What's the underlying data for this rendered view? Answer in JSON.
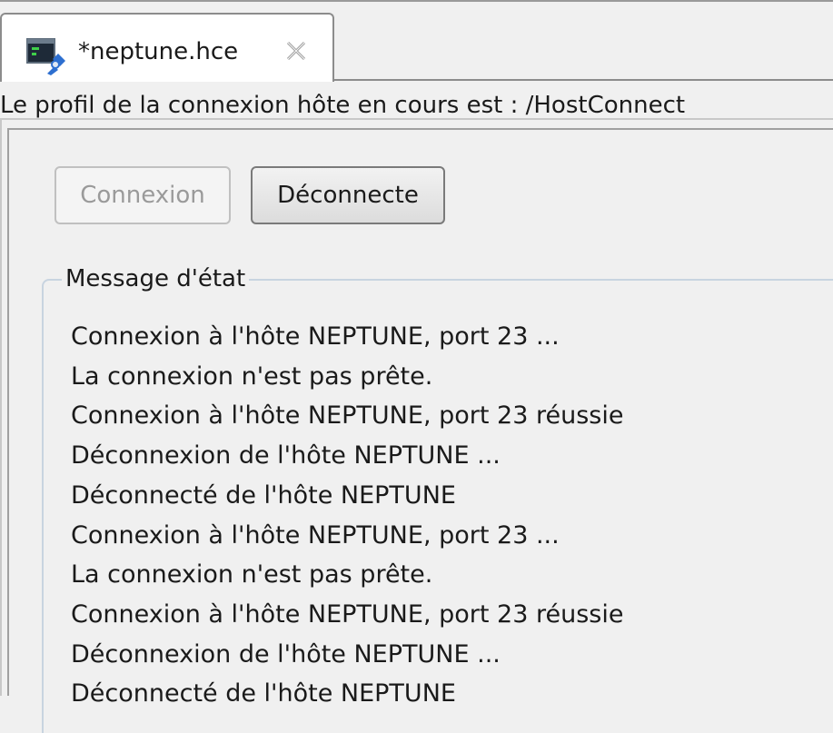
{
  "tab": {
    "title": "*neptune.hce",
    "icon": "host-terminal-icon",
    "close_icon": "close-icon"
  },
  "profile_line": "Le profil de la connexion hôte en cours est : /HostConnect",
  "buttons": {
    "connect_label": "Connexion",
    "disconnect_label": "Déconnecte"
  },
  "status": {
    "legend": "Message d'état",
    "messages": [
      "Connexion à l'hôte NEPTUNE, port 23 ...",
      "La connexion n'est pas prête.",
      "Connexion à l'hôte NEPTUNE, port 23 réussie",
      "Déconnexion de l'hôte NEPTUNE ...",
      "Déconnecté de l'hôte NEPTUNE",
      "Connexion à l'hôte NEPTUNE, port 23 ...",
      "La connexion n'est pas prête.",
      "Connexion à l'hôte NEPTUNE, port 23 réussie",
      "Déconnexion de l'hôte NEPTUNE ...",
      "Déconnecté de l'hôte NEPTUNE"
    ]
  },
  "colors": {
    "background": "#f0f0f0",
    "disabled_text": "#9a9a9a",
    "group_border": "#c8d4e0"
  }
}
